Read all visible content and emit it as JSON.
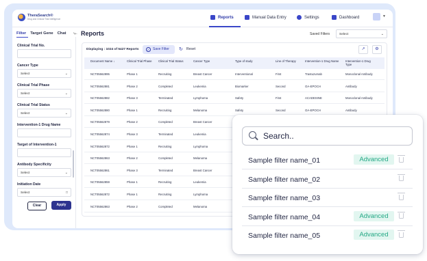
{
  "app": {
    "logo_line1": "TheraSearch®",
    "logo_line2": "Drug and Clinical Trial Intelligence"
  },
  "nav": [
    {
      "label": "Reports",
      "icon": "reports-icon",
      "color": "#3a46c8"
    },
    {
      "label": "Manual Data Entry",
      "icon": "edit-icon",
      "color": "#3a46c8"
    },
    {
      "label": "Settings",
      "icon": "gear-icon",
      "color": "#3a46c8"
    },
    {
      "label": "Dashboard",
      "icon": "dashboard-icon",
      "color": "#3a46c8"
    }
  ],
  "sidebar": {
    "tabs": [
      "Filter",
      "Target Gene",
      "Chat"
    ],
    "collapse_icon": "←",
    "filters": [
      {
        "label": "Clinical Trial No.",
        "value": ""
      },
      {
        "label": "Cancer Type",
        "value": "Select"
      },
      {
        "label": "Clinical Trial Phase",
        "value": "Select"
      },
      {
        "label": "Clinical Trial Status",
        "value": "Select"
      },
      {
        "label": "Intervention-1 Drug Name",
        "value": ""
      },
      {
        "label": "Target of Intervention-1",
        "value": ""
      },
      {
        "label": "Antibody Specificity",
        "value": "Select"
      },
      {
        "label": "Initiation Date",
        "value": "Select"
      }
    ],
    "clear_label": "Clear",
    "apply_label": "Apply"
  },
  "main": {
    "title": "Reports",
    "saved_filters_label": "Saved Filters",
    "saved_filters_value": "Select",
    "display_text": "Displaying : 1024 of 5427 Reports",
    "save_filter_label": "Save Filter",
    "reset_label": "Reset",
    "columns": [
      "Document Name ↓",
      "Clinical Trial Phase",
      "Clinical Trial Status",
      "Cancer Type",
      "Type of study",
      "Line of Therapy",
      "Intervention-1 Drug Name",
      "Intervention-1 Drug Type"
    ],
    "rows": [
      [
        "NCT05562895",
        "Phase 1",
        "Recruiting",
        "Breast Cancer",
        "Interventional",
        "First",
        "Trastuzumab",
        "Monoclonal Antibody"
      ],
      [
        "NCT05562881",
        "Phase 2",
        "Completed",
        "Leukemia",
        "Biomarker",
        "Second",
        "OA-EPOCH",
        "Antibody"
      ],
      [
        "NCT05562882",
        "Phase 3",
        "Terminated",
        "Lymphoma",
        "Safety",
        "First",
        "ACADESINE",
        "Monoclonal Antibody"
      ],
      [
        "NCT05562880",
        "Phase 1",
        "Recruiting",
        "Melanoma",
        "Safety",
        "Second",
        "OA-EPOCH",
        "Antibody"
      ],
      [
        "NCT05562879",
        "Phase 2",
        "Completed",
        "Breast Cancer",
        "",
        "",
        "",
        ""
      ],
      [
        "NCT05562874",
        "Phase 3",
        "Terminated",
        "Leukemia",
        "",
        "",
        "",
        ""
      ],
      [
        "NCT05562872",
        "Phase 1",
        "Recruiting",
        "Lymphoma",
        "",
        "",
        "",
        ""
      ],
      [
        "NCT05562863",
        "Phase 2",
        "Completed",
        "Melanoma",
        "",
        "",
        "",
        ""
      ],
      [
        "NCT05562861",
        "Phase 3",
        "Terminated",
        "Breast Cancer",
        "",
        "",
        "",
        ""
      ],
      [
        "NCT05562859",
        "Phase 1",
        "Recruiting",
        "Leukemia",
        "",
        "",
        "",
        ""
      ],
      [
        "NCT05562872",
        "Phase 1",
        "Recruiting",
        "Lymphoma",
        "",
        "",
        "",
        ""
      ],
      [
        "NCT05562863",
        "Phase 2",
        "Completed",
        "Melanoma",
        "",
        "",
        "",
        ""
      ]
    ]
  },
  "popup": {
    "search_placeholder": "Search..",
    "items": [
      {
        "name": "Sample filter name_01",
        "badge": "Advanced"
      },
      {
        "name": "Sample filter name_02",
        "badge": ""
      },
      {
        "name": "Sample filter name_03",
        "badge": ""
      },
      {
        "name": "Sample filter name_04",
        "badge": "Advanced"
      },
      {
        "name": "Sample filter name_05",
        "badge": "Advanced"
      }
    ]
  }
}
